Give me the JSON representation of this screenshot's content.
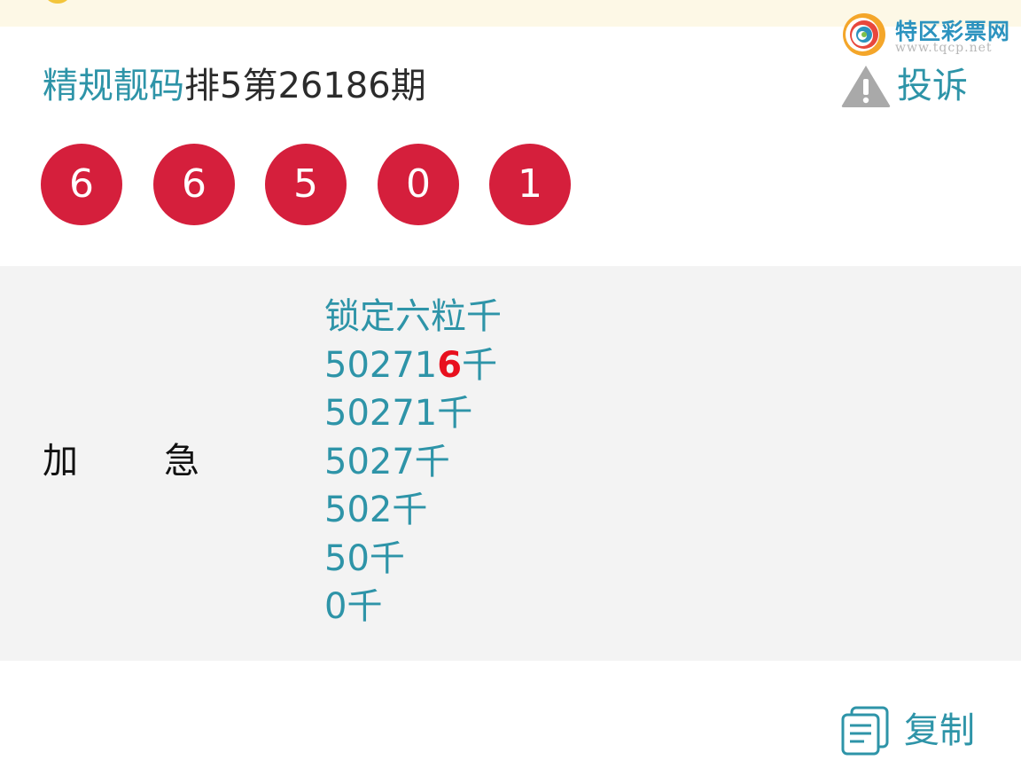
{
  "watermark": {
    "title": "特区彩票网",
    "url": "www.tqcp.net"
  },
  "header": {
    "title_accent": "精规靓码",
    "title_main": "排5第26186期",
    "complaint_label": "投诉"
  },
  "balls": [
    "6",
    "6",
    "5",
    "0",
    "1"
  ],
  "panel": {
    "label_left": "加",
    "label_right": "急",
    "lines": [
      {
        "text": "锁定六粒千",
        "pre": "",
        "hl": "",
        "post": ""
      },
      {
        "text": "",
        "pre": "50271",
        "hl": "6",
        "post": "千"
      },
      {
        "text": "50271千",
        "pre": "",
        "hl": "",
        "post": ""
      },
      {
        "text": "5027千",
        "pre": "",
        "hl": "",
        "post": ""
      },
      {
        "text": "502千",
        "pre": "",
        "hl": "",
        "post": ""
      },
      {
        "text": "50千",
        "pre": "",
        "hl": "",
        "post": ""
      },
      {
        "text": "0千",
        "pre": "",
        "hl": "",
        "post": ""
      }
    ]
  },
  "footer": {
    "copy_label": "复制"
  },
  "colors": {
    "accent": "#2e94a8",
    "ball": "#d51f3c",
    "highlight": "#e8101e",
    "panel_bg": "#f3f3f3"
  },
  "icons": {
    "complaint": "warning-triangle-icon",
    "copy": "document-copy-icon",
    "watermark_logo": "swirl-logo-icon"
  }
}
